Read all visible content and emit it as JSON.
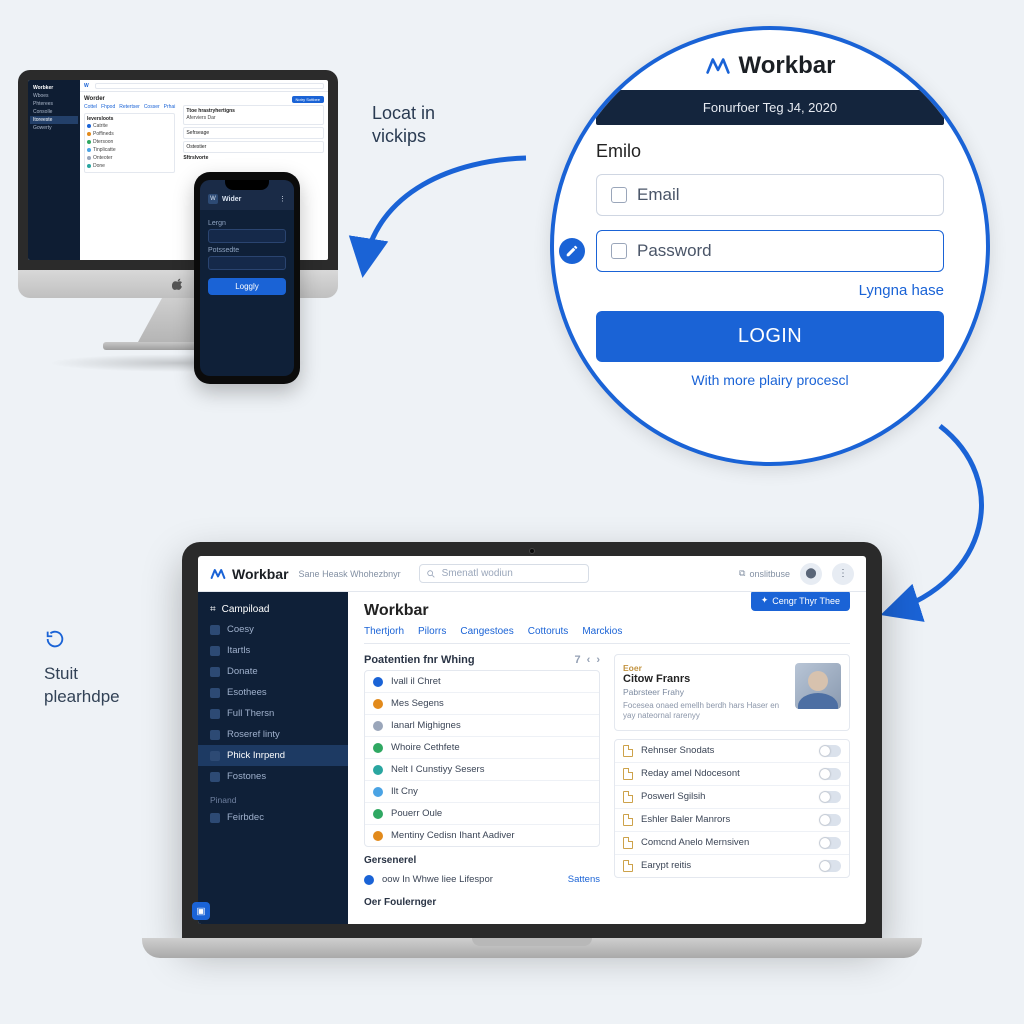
{
  "brand": {
    "name": "Workbar"
  },
  "annotations": {
    "locat_in": "Locat in\nvickips",
    "stut": "Stuit\nplearhdpe"
  },
  "imac": {
    "sidebar": {
      "brand": "Worbker",
      "items": [
        "Wboes",
        "Phterees",
        "Consolle",
        "Itoreeste",
        "Gowerty"
      ],
      "activeIndex": 3
    },
    "header": {
      "title": "Worder",
      "tabs": [
        "Cottel",
        "Fhpod",
        "Retertser",
        "Cosser",
        "Prhai"
      ],
      "button": "Notry Sottbee"
    },
    "left_panel": {
      "title": "Ieversloots",
      "rows": [
        "Catrite",
        "Poffineds",
        "Dtersoon",
        "Tinplicatte",
        "Onteoter",
        "Done"
      ]
    },
    "right_panel": {
      "title": "Ttoe hrastryhertigns",
      "cards": [
        "Aferviers Dar",
        "Sefrseage",
        "Ostestier"
      ],
      "sub": "Sftrslvorte"
    }
  },
  "phone": {
    "brand": "Wider",
    "labels": {
      "login": "Lergn",
      "password": "Potssedte"
    },
    "button": "Loggly"
  },
  "login": {
    "datebar": "Fonurfoer  Teg J4, 2020",
    "title": "Emilo",
    "email_label": "Email",
    "password_label": "Password",
    "forgot": "Lyngna hase",
    "button": "LOGIN",
    "subtext": "With more plairy procescl"
  },
  "laptop": {
    "topbar": {
      "crumb": "Sane Heask Whohezbnyr",
      "search_placeholder": "Smenatl wodiun",
      "right_link": "onslitbuse"
    },
    "sidebar": {
      "title": "Campiload",
      "items": [
        "Coesy",
        "Itartls",
        "Donate",
        "Esothees",
        "Full Thersn",
        "Roseref linty",
        "Phick Inrpend",
        "Fostones"
      ],
      "activeIndex": 6,
      "group2_title": "Pinand",
      "group2_items": [
        "Feirbdec"
      ]
    },
    "content": {
      "title": "Workbar",
      "tabs": [
        "Thertjorh",
        "Pilorrs",
        "Cangestoes",
        "Cottoruts",
        "Marckios"
      ],
      "primary_button": "Cengr Thyr Thee",
      "left": {
        "heading": "Poatentien fnr Whing",
        "count": "7",
        "items": [
          {
            "label": "Ivall il Chret",
            "color": "c-blue"
          },
          {
            "label": "Mes Segens",
            "color": "c-orange"
          },
          {
            "label": "Ianarl Mighignes",
            "color": "c-gray"
          },
          {
            "label": "Whoire Cethfete",
            "color": "c-green"
          },
          {
            "label": "Nelt I Cunstiyy Sesers",
            "color": "c-teal"
          },
          {
            "label": "Ilt Cny",
            "color": "c-sky"
          },
          {
            "label": "Pouerr Oule",
            "color": "c-green"
          },
          {
            "label": "Mentiny Cedisn Ihant Aadiver",
            "color": "c-orange"
          }
        ],
        "sub_heading": "Gersenerel",
        "sub_row": "oow In Whwe liee Lifespor",
        "sub_row_action": "Sattens",
        "footer_heading": "Oer Foulernger"
      },
      "right": {
        "user": {
          "role": "Eoer",
          "name": "Citow Franrs",
          "sub": "Pabrsteer Frahy",
          "desc": "Focesea onaed emellh berdh hars Haser en yay nateornal rarenyy"
        },
        "rows": [
          "Rehnser Snodats",
          "Reday amel Ndocesont",
          "Poswerl Sgilsih",
          "Eshler Baler Manrors",
          "Comcnd Anelo Mernsiven",
          "Earypt reitis"
        ]
      }
    }
  }
}
